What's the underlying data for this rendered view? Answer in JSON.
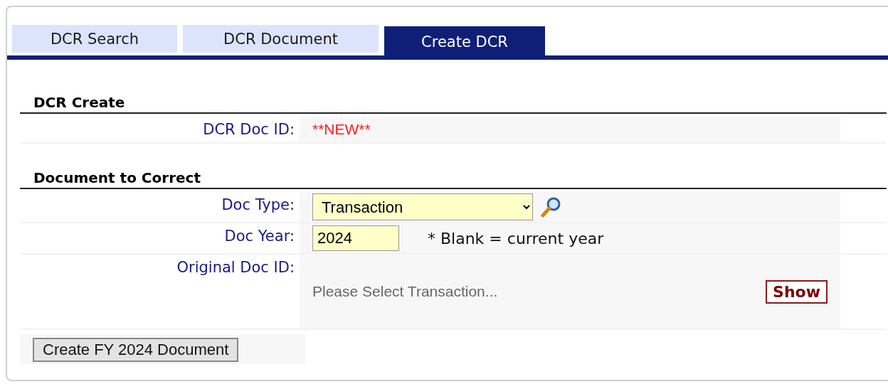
{
  "tabs": [
    {
      "label": "DCR Search",
      "selected": false
    },
    {
      "label": "DCR Document",
      "selected": false
    },
    {
      "label": "Create DCR",
      "selected": true
    }
  ],
  "sections": [
    {
      "title": "DCR Create",
      "rows": [
        {
          "kind": "text",
          "label": "DCR Doc ID:",
          "value": "**NEW**"
        }
      ]
    },
    {
      "title": "Document to Correct",
      "rows": [
        {
          "kind": "select",
          "label": "Doc Type:",
          "value": "Transaction"
        },
        {
          "kind": "year",
          "label": "Doc Year:",
          "value": "2024",
          "hint": "* Blank = current year"
        },
        {
          "kind": "lookup",
          "label": "Original Doc ID:",
          "prompt": "Please Select Transaction...",
          "button": "Show"
        }
      ]
    }
  ],
  "create_button": "Create FY 2024 Document"
}
